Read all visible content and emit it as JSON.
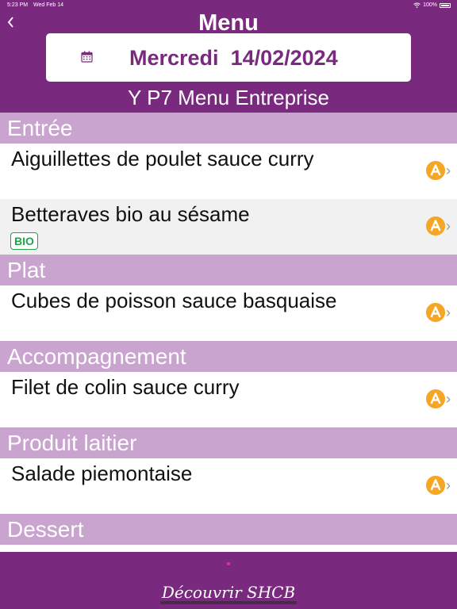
{
  "status_bar": {
    "time": "5:23 PM",
    "date": "Wed Feb 14",
    "battery": "100%"
  },
  "header": {
    "title": "Menu",
    "day": "Mercredi",
    "date": "14/02/2024",
    "subtitle": "Y P7 Menu Entreprise"
  },
  "sections": [
    {
      "title": "Entrée",
      "items": [
        {
          "name": "Aiguillettes de poulet sauce curry"
        },
        {
          "name": "Betteraves bio au sésame",
          "badge": "BIO"
        }
      ]
    },
    {
      "title": "Plat",
      "items": [
        {
          "name": "Cubes de poisson sauce basquaise"
        }
      ]
    },
    {
      "title": "Accompagnement",
      "items": [
        {
          "name": "Filet de colin sauce curry"
        }
      ]
    },
    {
      "title": "Produit laitier",
      "items": [
        {
          "name": "Salade piemontaise"
        }
      ]
    },
    {
      "title": "Dessert",
      "items": []
    }
  ],
  "footer": {
    "link": "Découvrir SHCB"
  },
  "colors": {
    "brand": "#7a2a7e",
    "section": "#c9a4cf",
    "allergen": "#f5a623",
    "bio": "#1fa24a"
  },
  "icons": {
    "back": "chevron-left-icon",
    "calendar": "calendar-icon",
    "allergen": "allergen-a-icon",
    "row_nav": "chevron-right-icon"
  }
}
